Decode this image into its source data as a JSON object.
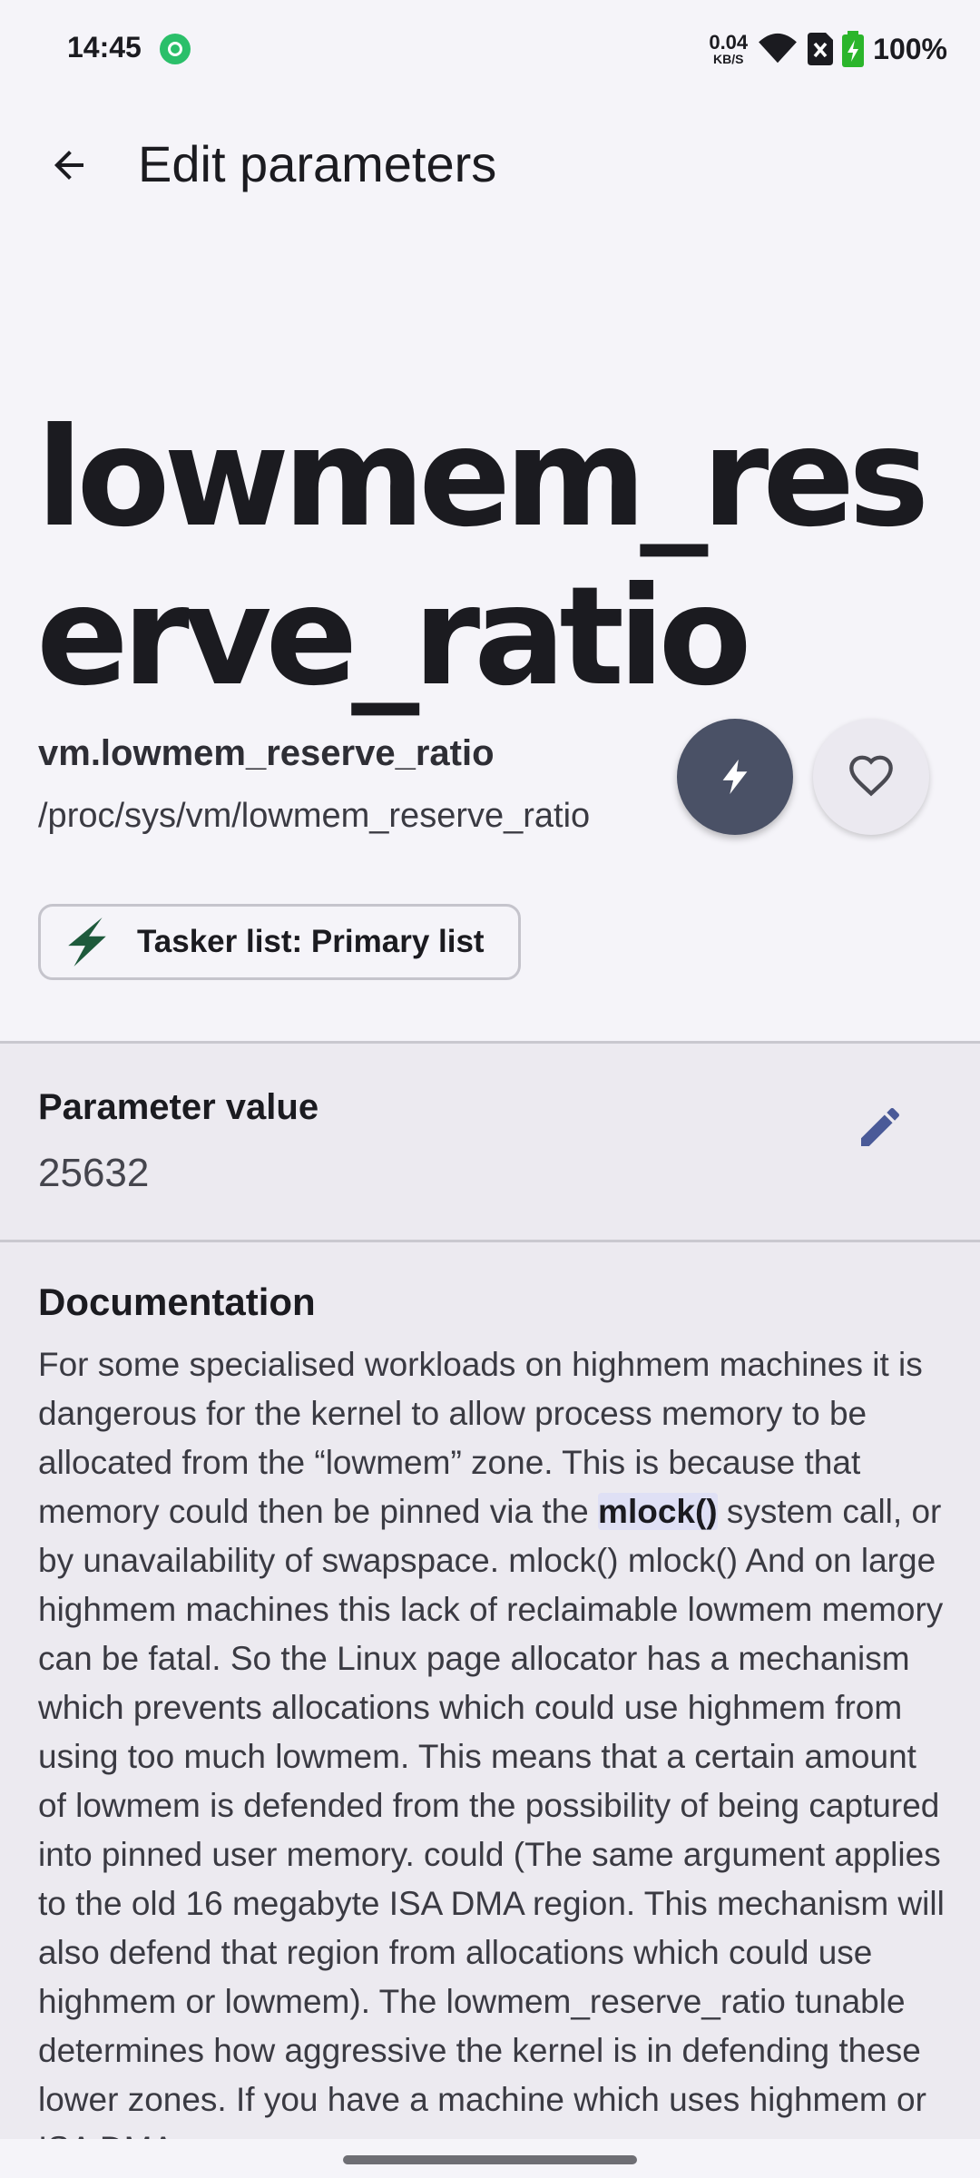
{
  "status_bar": {
    "time": "14:45",
    "net_speed_value": "0.04",
    "net_speed_unit": "KB/S",
    "battery": "100%",
    "icons": [
      "app-notification-icon",
      "wifi-icon",
      "no-sim-icon",
      "battery-charging-icon"
    ]
  },
  "topbar": {
    "title": "Edit parameters",
    "back_icon": "arrow-back-icon"
  },
  "parameter": {
    "display_name": "lowmem_reserve_ratio",
    "sysctl_name": "vm.lowmem_reserve_ratio",
    "path": "/proc/sys/vm/lowmem_reserve_ratio"
  },
  "actions": {
    "apply_icon": "flash-icon",
    "favorite_icon": "heart-outline-icon"
  },
  "tasker_chip": {
    "label": "Tasker list: Primary list",
    "icon": "tasker-bolt-icon"
  },
  "value_section": {
    "label": "Parameter value",
    "value": "25632",
    "edit_icon": "pencil-icon"
  },
  "documentation": {
    "title": "Documentation",
    "text_before": "For some specialised workloads on highmem machines it is dangerous for the kernel to allow process memory to be allocated from the “lowmem” zone. This is because that memory could then be pinned via the ",
    "highlight": "mlock()",
    "text_after": " system call, or by unavailability of swapspace. mlock() mlock() And on large highmem machines this lack of reclaimable lowmem memory can be fatal. So the Linux page allocator has a mechanism which prevents allocations which could use highmem from using too much lowmem. This means that a certain amount of lowmem is defended from the possibility of being captured into pinned user memory. could (The same argument applies to the old 16 megabyte ISA DMA region. This mechanism will also defend that region from allocations which could use highmem or lowmem). The lowmem_reserve_ratio tunable determines how aggressive the kernel is in defending these lower zones. If you have a machine which uses highmem or ISA DMA"
  },
  "colors": {
    "background": "#f5f4f9",
    "section_background": "#eceaf0",
    "apply_button": "#4a5166",
    "edit_icon": "#4a5a98",
    "tasker_green": "#1e5a3c",
    "highlight": "#dfe0f5"
  }
}
